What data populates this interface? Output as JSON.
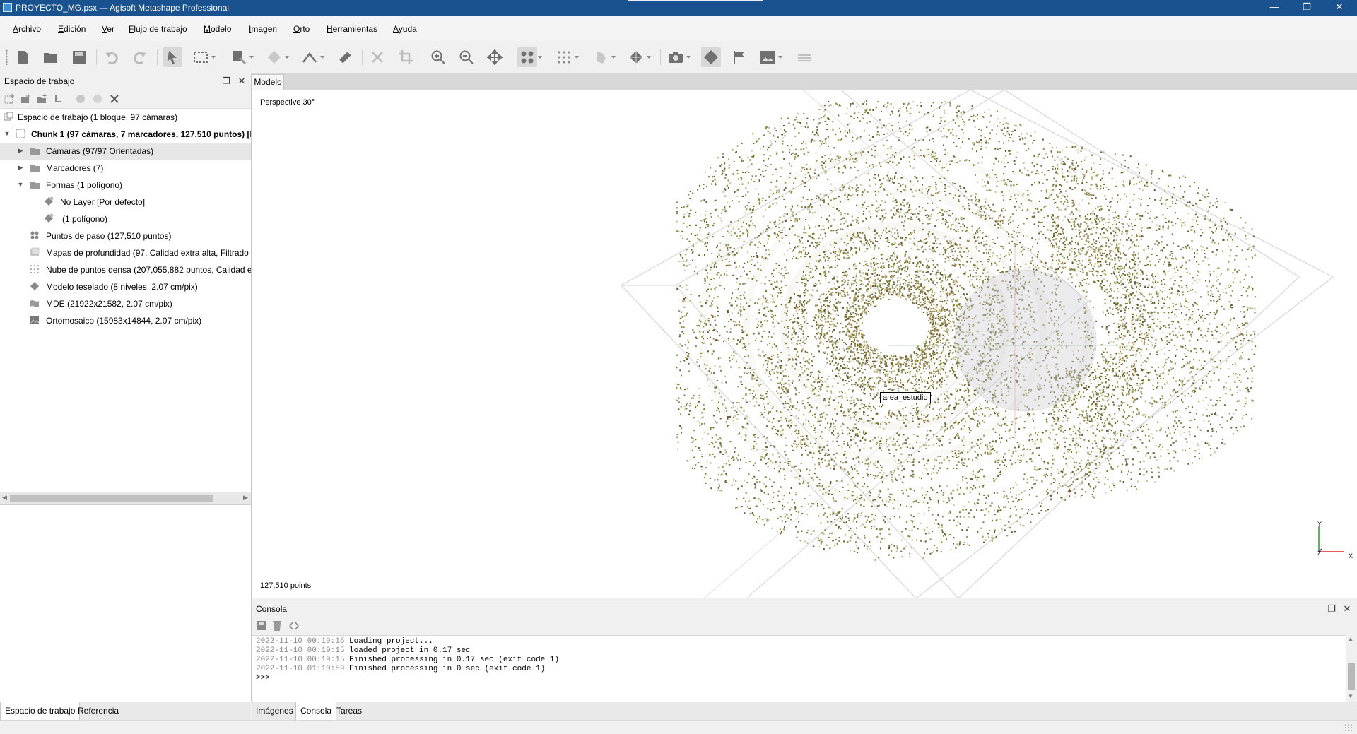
{
  "window": {
    "title": "PROYECTO_MG.psx — Agisoft Metashape Professional",
    "controls": {
      "minimize": "—",
      "restore": "❐",
      "close": "✕"
    }
  },
  "menu": {
    "items": [
      {
        "label": "Archivo",
        "mn": "A",
        "rest": "rchivo"
      },
      {
        "label": "Edición",
        "mn": "E",
        "rest": "dición"
      },
      {
        "label": "Ver",
        "mn": "V",
        "rest": "er"
      },
      {
        "label": "Flujo de trabajo",
        "mn": "F",
        "rest": "lujo de trabajo"
      },
      {
        "label": "Modelo",
        "mn": "M",
        "rest": "odelo"
      },
      {
        "label": "Imagen",
        "mn": "I",
        "rest": "magen"
      },
      {
        "label": "Orto",
        "mn": "O",
        "rest": "rto"
      },
      {
        "label": "Herramientas",
        "mn": "H",
        "rest": "erramientas"
      },
      {
        "label": "Ayuda",
        "mn": "A",
        "rest": "yuda"
      }
    ]
  },
  "workspace": {
    "title": "Espacio de trabajo",
    "root": "Espacio de trabajo (1 bloque, 97 cámaras)",
    "chunk": "Chunk 1 (97 cámaras, 7 marcadores, 127,510 puntos) [R]",
    "items": {
      "cameras": "Cámaras (97/97 Orientadas)",
      "markers": "Marcadores (7)",
      "shapes": "Formas (1 polígono)",
      "no_layer": "No Layer [Por defecto]",
      "polygon": "(1 polígono)",
      "tie_points": "Puntos de paso (127,510 puntos)",
      "depth_maps": "Mapas de profundidad (97, Calidad extra alta, Filtrado a",
      "dense_cloud": "Nube de puntos densa (207,055,882 puntos, Calidad ext",
      "tiled_model": "Modelo teselado (8 niveles, 2.07 cm/pix)",
      "dem": "MDE (21922x21582, 2.07 cm/pix)",
      "orthomosaic": "Ortomosaico (15983x14844, 2.07 cm/pix)"
    }
  },
  "left_tabs": {
    "workspace": "Espacio de trabajo",
    "reference": "Referencia"
  },
  "model": {
    "tab": "Modelo",
    "perspective": "Perspective 30°",
    "points_count": "127,510 points",
    "shape_label": "area_estudio",
    "axis": {
      "y": "Y",
      "x": "X",
      "z": "Z"
    },
    "colors": {
      "point_dark": "#6b5a2a",
      "point_mid": "#9a8a4a",
      "point_light": "#c9c09a",
      "point_green": "#6f7a2a"
    }
  },
  "console": {
    "title": "Consola",
    "lines": [
      {
        "ts": "2022-11-10 00:19:15",
        "msg": " Loading project..."
      },
      {
        "ts": "2022-11-10 00:19:15",
        "msg": " loaded project in 0.17 sec"
      },
      {
        "ts": "2022-11-10 00:19:15",
        "msg": " Finished processing in 0.17 sec (exit code 1)"
      },
      {
        "ts": "2022-11-10 01:10:59",
        "msg": " Finished processing in 0 sec (exit code 1)"
      }
    ],
    "prompt": ">>>"
  },
  "bottom_tabs": {
    "images": "Imágenes",
    "console": "Consola",
    "tasks": "Tareas"
  }
}
